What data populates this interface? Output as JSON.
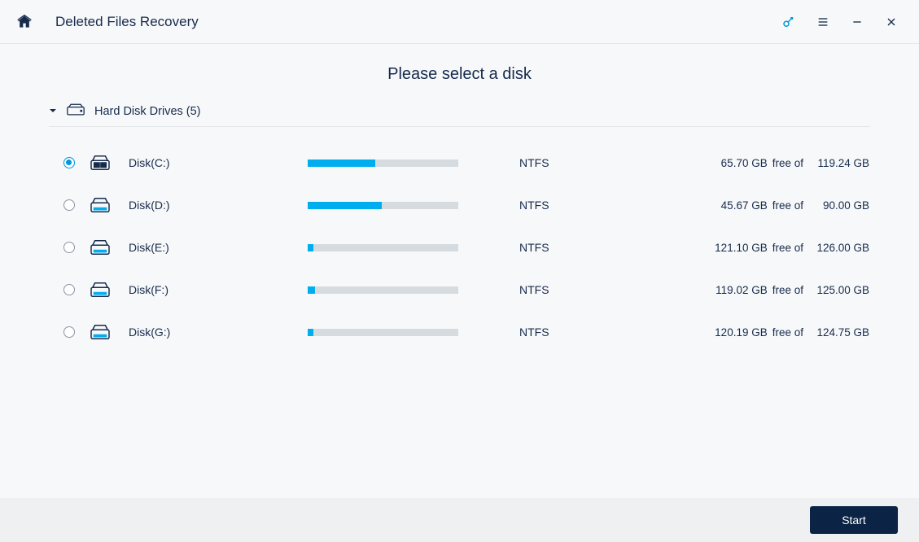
{
  "titlebar": {
    "title": "Deleted Files Recovery"
  },
  "page": {
    "heading": "Please select a disk",
    "section_label": "Hard Disk Drives (5)"
  },
  "labels": {
    "free_of": "free of"
  },
  "footer": {
    "start_label": "Start"
  },
  "disks": [
    {
      "selected": true,
      "system": true,
      "name": "Disk(C:)",
      "fs": "NTFS",
      "free": "65.70 GB",
      "total": "119.24 GB",
      "used_pct": 45
    },
    {
      "selected": false,
      "system": false,
      "name": "Disk(D:)",
      "fs": "NTFS",
      "free": "45.67 GB",
      "total": "90.00 GB",
      "used_pct": 49
    },
    {
      "selected": false,
      "system": false,
      "name": "Disk(E:)",
      "fs": "NTFS",
      "free": "121.10 GB",
      "total": "126.00 GB",
      "used_pct": 4
    },
    {
      "selected": false,
      "system": false,
      "name": "Disk(F:)",
      "fs": "NTFS",
      "free": "119.02 GB",
      "total": "125.00 GB",
      "used_pct": 5
    },
    {
      "selected": false,
      "system": false,
      "name": "Disk(G:)",
      "fs": "NTFS",
      "free": "120.19 GB",
      "total": "124.75 GB",
      "used_pct": 4
    }
  ]
}
